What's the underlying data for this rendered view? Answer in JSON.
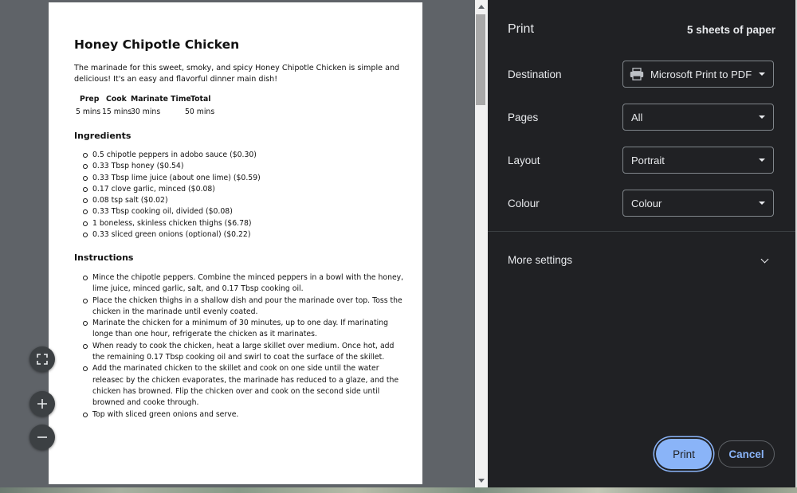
{
  "recipe": {
    "title": "Honey Chipotle Chicken",
    "intro": "The marinade for this sweet, smoky, and spicy Honey Chipotle Chicken is simple and delicious! It's an easy and flavorful dinner main dish!",
    "times_header": [
      "Prep",
      "Cook",
      "Marinate Time",
      "Total"
    ],
    "times_values": [
      "5 mins",
      "15 mins",
      "30 mins",
      "50 mins"
    ],
    "ingredients_heading": "Ingredients",
    "ingredients": [
      "0.5 chipotle peppers in adobo sauce ($0.30)",
      "0.33 Tbsp honey ($0.54)",
      "0.33 Tbsp lime juice (about one lime) ($0.59)",
      "0.17 clove garlic, minced ($0.08)",
      "0.08 tsp salt ($0.02)",
      "0.33 Tbsp cooking oil, divided ($0.08)",
      "1 boneless, skinless chicken thighs ($6.78)",
      "0.33 sliced green onions (optional) ($0.22)"
    ],
    "instructions_heading": "Instructions",
    "instructions": [
      "Mince the chipotle peppers. Combine the minced peppers in a bowl with the honey, lime juice, minced garlic, salt, and 0.17 Tbsp cooking oil.",
      "Place the chicken thighs in a shallow dish and pour the marinade over top. Toss the chicken in the marinade until evenly coated.",
      "Marinate the chicken for a minimum of 30 minutes, up to one day. If marinating longe than one hour, refrigerate the chicken as it marinates.",
      "When ready to cook the chicken, heat a large skillet over medium. Once hot, add the remaining 0.17 Tbsp cooking oil and swirl to coat the surface of the skillet.",
      "Add the marinated chicken to the skillet and cook on one side until the water releasec by the chicken evaporates, the marinade has reduced to a glaze, and the chicken has browned. Flip the chicken over and cook on the second side until browned and cooke through.",
      "Top with sliced green onions and serve."
    ]
  },
  "print_panel": {
    "title": "Print",
    "sheets": "5 sheets of paper",
    "destination_label": "Destination",
    "destination_value": "Microsoft Print to PDF",
    "destination_icon": "printer-icon",
    "pages_label": "Pages",
    "pages_value": "All",
    "layout_label": "Layout",
    "layout_value": "Portrait",
    "colour_label": "Colour",
    "colour_value": "Colour",
    "more_settings": "More settings",
    "print_button": "Print",
    "cancel_button": "Cancel"
  },
  "preview_controls": {
    "fit_icon": "fit-to-page-icon",
    "zoom_in_icon": "zoom-in-icon",
    "zoom_out_icon": "zoom-out-icon"
  },
  "colors": {
    "panel_bg": "#202124",
    "preview_bg": "#5f6368",
    "accent": "#8ab4f8"
  }
}
